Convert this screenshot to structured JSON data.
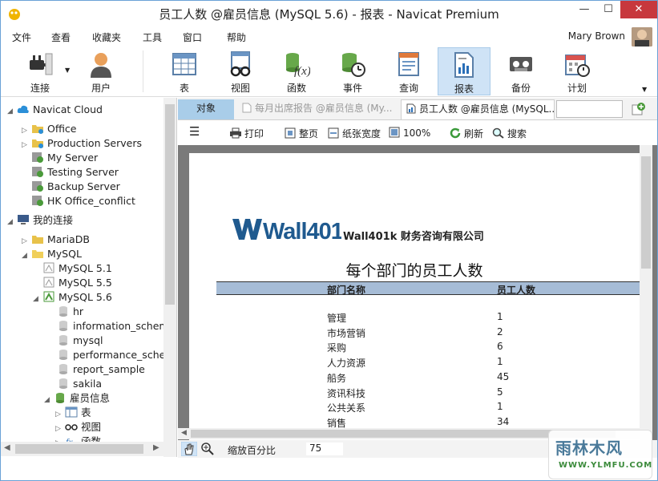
{
  "window": {
    "title": "员工人数 @雇员信息 (MySQL 5.6) - 报表 - Navicat Premium"
  },
  "menu": [
    "文件",
    "查看",
    "收藏夹",
    "工具",
    "窗口",
    "帮助"
  ],
  "user": {
    "name": "Mary Brown"
  },
  "toolbar": [
    {
      "label": "连接",
      "icon": "plug-icon"
    },
    {
      "label": "用户",
      "icon": "user-icon"
    },
    {
      "label": "表",
      "icon": "table-icon"
    },
    {
      "label": "视图",
      "icon": "view-glasses-icon"
    },
    {
      "label": "函数",
      "icon": "function-icon"
    },
    {
      "label": "事件",
      "icon": "event-clock-icon"
    },
    {
      "label": "查询",
      "icon": "query-icon"
    },
    {
      "label": "报表",
      "icon": "report-icon"
    },
    {
      "label": "备份",
      "icon": "backup-tape-icon"
    },
    {
      "label": "计划",
      "icon": "calendar-icon"
    }
  ],
  "sidebar": {
    "items": [
      {
        "label": "Navicat Cloud"
      },
      {
        "label": "Office"
      },
      {
        "label": "Production Servers"
      },
      {
        "label": "My Server"
      },
      {
        "label": "Testing Server"
      },
      {
        "label": "Backup Server"
      },
      {
        "label": "HK Office_conflict"
      },
      {
        "label": "我的连接"
      },
      {
        "label": "MariaDB"
      },
      {
        "label": "MySQL"
      },
      {
        "label": "MySQL 5.1"
      },
      {
        "label": "MySQL 5.5"
      },
      {
        "label": "MySQL 5.6"
      },
      {
        "label": "hr"
      },
      {
        "label": "information_schema"
      },
      {
        "label": "mysql"
      },
      {
        "label": "performance_schema"
      },
      {
        "label": "report_sample"
      },
      {
        "label": "sakila"
      },
      {
        "label": "雇员信息"
      },
      {
        "label": "表"
      },
      {
        "label": "视图"
      },
      {
        "label": "函数"
      }
    ]
  },
  "tabs": {
    "objects": "对象",
    "tab1": "每月出席报告 @雇员信息 (My...",
    "tab2": "员工人数 @雇员信息 (MySQL..."
  },
  "report_toolbar": {
    "print": "打印",
    "fit_page": "整页",
    "page_width": "纸张宽度",
    "zoom100": "100%",
    "refresh": "刷新",
    "search": "搜索"
  },
  "report": {
    "logo_text": "Wall401K",
    "company": "Wall401k 财务咨询有限公司",
    "title": "每个部门的员工人数",
    "col1": "部门名称",
    "col2": "员工人数",
    "rows": [
      {
        "dept": "管理",
        "count": "1"
      },
      {
        "dept": "市场营销",
        "count": "2"
      },
      {
        "dept": "采购",
        "count": "6"
      },
      {
        "dept": "人力资源",
        "count": "1"
      },
      {
        "dept": "船务",
        "count": "45"
      },
      {
        "dept": "资讯科技",
        "count": "5"
      },
      {
        "dept": "公共关系",
        "count": "1"
      },
      {
        "dept": "销售",
        "count": "34"
      }
    ]
  },
  "status": {
    "zoom_label": "缩放百分比",
    "zoom_value": "75"
  },
  "watermark": {
    "big": "雨林木风",
    "small": "WWW.YLMFU.COM"
  },
  "colors": {
    "accent": "#1f7bc9",
    "tab_active": "#a9cde9",
    "header_band": "#a6bcd6"
  }
}
